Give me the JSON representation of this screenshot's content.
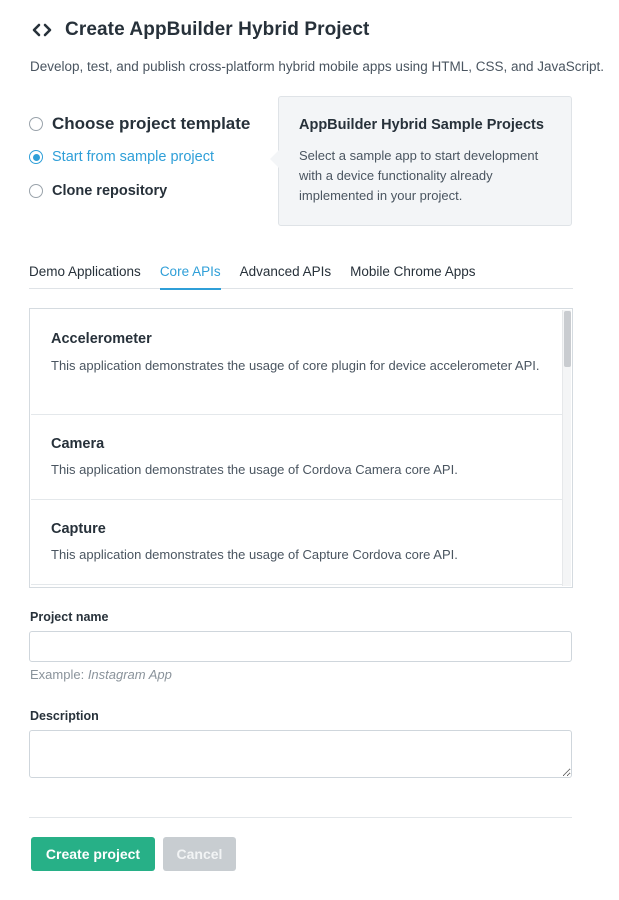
{
  "header": {
    "icon": "code-brackets-icon",
    "title": "Create AppBuilder Hybrid Project",
    "subtitle": "Develop, test, and publish cross-platform hybrid mobile apps using HTML, CSS, and JavaScript."
  },
  "options": [
    {
      "label": "Choose project template",
      "checked": false
    },
    {
      "label": "Start from sample project",
      "checked": true
    },
    {
      "label": "Clone repository",
      "checked": false
    }
  ],
  "info_card": {
    "title": "AppBuilder Hybrid Sample Projects",
    "text": "Select a sample app to start development with a device functionality already implemented in your project."
  },
  "tabs": [
    {
      "label": "Demo Applications",
      "active": false
    },
    {
      "label": "Core APIs",
      "active": true
    },
    {
      "label": "Advanced APIs",
      "active": false
    },
    {
      "label": "Mobile Chrome Apps",
      "active": false
    }
  ],
  "samples": [
    {
      "title": "Accelerometer",
      "description": "This application demonstrates the usage of core plugin for device accelerometer API."
    },
    {
      "title": "Camera",
      "description": "This application demonstrates the usage of Cordova Camera core API."
    },
    {
      "title": "Capture",
      "description": "This application demonstrates the usage of Capture Cordova core API."
    }
  ],
  "form": {
    "project_name_label": "Project name",
    "project_name_value": "",
    "hint_prefix": "Example: ",
    "hint_example": "Instagram App",
    "description_label": "Description",
    "description_value": ""
  },
  "buttons": {
    "create": "Create project",
    "cancel": "Cancel"
  },
  "colors": {
    "accent": "#2f9fd8",
    "primary_button": "#27b087",
    "disabled_button": "#c8cdd1"
  }
}
